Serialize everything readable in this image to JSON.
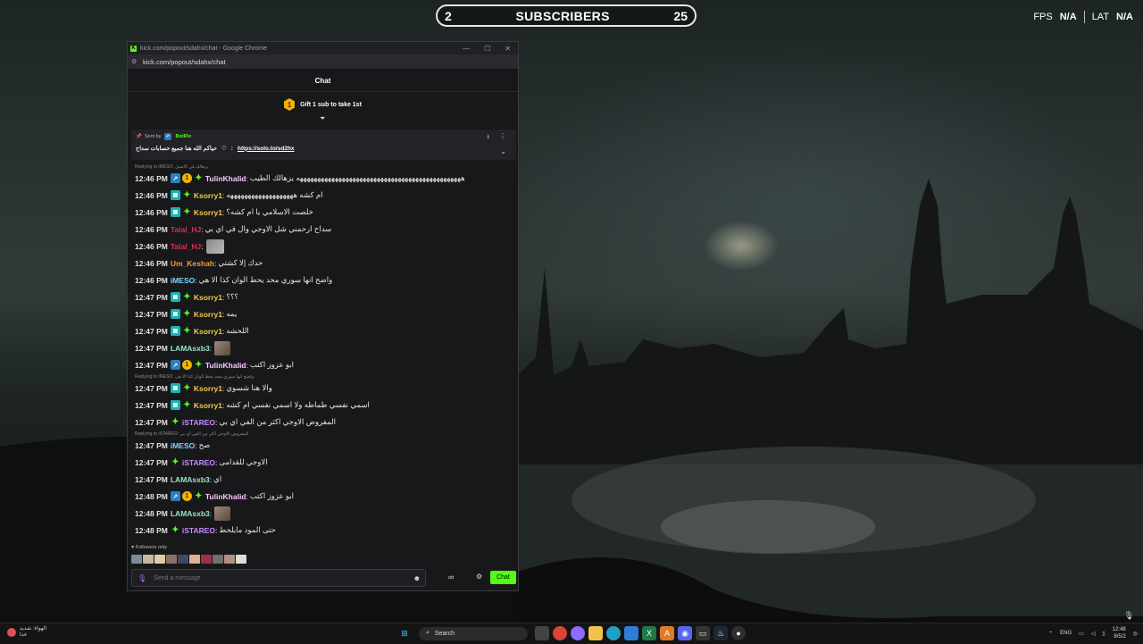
{
  "overlay": {
    "subscribers_left": "2",
    "subscribers_label": "SUBSCRIBERS",
    "subscribers_right": "25",
    "fps_label": "FPS",
    "fps_value": "N/A",
    "lat_label": "LAT",
    "lat_value": "N/A"
  },
  "window": {
    "title": "kick.com/popout/sdahx/chat - Google Chrome",
    "url": "kick.com/popout/sdahx/chat"
  },
  "chat": {
    "header": "Chat",
    "gift_rank": "1",
    "gift_text": "Gift 1 sub to take 1st",
    "pinned": {
      "sent_by": "Sent by",
      "bot_name": "BotRix",
      "message": "حياكم الله هنا جميع حسابات سداح",
      "link": "https://solo.to/sd2hx"
    },
    "messages": [
      {
        "reply": "Replying to iMESO: يزهالك في الاصيل",
        "time": "12:46 PM",
        "badges": [
          "blue",
          "gold",
          "star"
        ],
        "user": "TulinKhalid",
        "color": "#fcc8ff",
        "text": "هههههههههههههههههههههههههههههههههههههههههههههههه يزهالك الطيب"
      },
      {
        "time": "12:46 PM",
        "badges": [
          "teal",
          "star"
        ],
        "user": "Ksorry1",
        "color": "#f2c94c",
        "text": "ام كشه هههههههههههههههههههه"
      },
      {
        "time": "12:46 PM",
        "badges": [
          "teal",
          "star"
        ],
        "user": "Ksorry1",
        "color": "#f2c94c",
        "text": "خلصت الاسلامي يا ام كشه؟"
      },
      {
        "time": "12:46 PM",
        "badges": [],
        "user": "Talal_HJ",
        "color": "#d9304f",
        "text": "سداح ارحمني شل الاوجي وال في اي بي"
      },
      {
        "time": "12:46 PM",
        "badges": [],
        "user": "Talal_HJ",
        "color": "#d9304f",
        "text": "",
        "emote": true
      },
      {
        "time": "12:46 PM",
        "badges": [],
        "user": "Um_Keshah",
        "color": "#f29b38",
        "text": "حدك إلا كشتي"
      },
      {
        "time": "12:46 PM",
        "badges": [],
        "user": "iMESO",
        "color": "#7fd3ff",
        "text": "واضح انها سوري محد يحط الوان كذا الا هي"
      },
      {
        "time": "12:47 PM",
        "badges": [
          "teal",
          "star"
        ],
        "user": "Ksorry1",
        "color": "#f2c94c",
        "text": "؟؟؟"
      },
      {
        "time": "12:47 PM",
        "badges": [
          "teal",
          "star"
        ],
        "user": "Ksorry1",
        "color": "#f2c94c",
        "text": "يمه"
      },
      {
        "time": "12:47 PM",
        "badges": [
          "teal",
          "star"
        ],
        "user": "Ksorry1",
        "color": "#f2c94c",
        "text": "اللحشه"
      },
      {
        "time": "12:47 PM",
        "badges": [],
        "user": "LAMAsxb3",
        "color": "#9be3c5",
        "text": "",
        "emote": true
      },
      {
        "time": "12:47 PM",
        "badges": [
          "blue",
          "gold",
          "star"
        ],
        "user": "TulinKhalid",
        "color": "#fcc8ff",
        "text": "ابو عزوز اكتب"
      },
      {
        "reply": "Replying to iMESO: واضح انها سوري محد يحط الوان كذا الا هي",
        "time": "12:47 PM",
        "badges": [
          "teal",
          "star"
        ],
        "user": "Ksorry1",
        "color": "#f2c94c",
        "text": "والا هنا شسوي"
      },
      {
        "time": "12:47 PM",
        "badges": [
          "teal",
          "star"
        ],
        "user": "Ksorry1",
        "color": "#f2c94c",
        "text": "اسمي نفسي طماطه ولا اسمي نفسي ام كشه"
      },
      {
        "time": "12:47 PM",
        "badges": [
          "star"
        ],
        "user": "iSTAREO",
        "color": "#c58cff",
        "text": "المفروض الاوجي اكثر من الفي اي بي"
      },
      {
        "reply": "Replying to iSTAREO: المفروض الاوجي اكثر من الفي اي بي",
        "time": "12:47 PM",
        "badges": [],
        "user": "iMESO",
        "color": "#7fd3ff",
        "text": "صح"
      },
      {
        "time": "12:47 PM",
        "badges": [
          "star"
        ],
        "user": "iSTAREO",
        "color": "#c58cff",
        "text": "الاوجي للقدامى"
      },
      {
        "time": "12:47 PM",
        "badges": [],
        "user": "LAMAsxb3",
        "color": "#9be3c5",
        "text": "اي"
      },
      {
        "time": "12:48 PM",
        "badges": [
          "blue",
          "gold",
          "star"
        ],
        "user": "TulinKhalid",
        "color": "#fcc8ff",
        "text": "ابو عزوز اكتب"
      },
      {
        "time": "12:48 PM",
        "badges": [],
        "user": "LAMAsxb3",
        "color": "#9be3c5",
        "text": "",
        "emote": true
      },
      {
        "time": "12:48 PM",
        "badges": [
          "star"
        ],
        "user": "iSTAREO",
        "color": "#c58cff",
        "text": "حتى المود مايلحط"
      }
    ],
    "followers_only": "Followers only",
    "input_placeholder": "Send a message",
    "chat_button": "Chat"
  },
  "taskbar": {
    "weather_line1": "الهواء: شديد",
    "weather_line2": "غدا",
    "search_label": "Search",
    "lang": "ENG",
    "time": "12:48",
    "date": "8/5/2"
  },
  "colors": {
    "kick_green": "#53fc18",
    "chat_bg": "#18181b"
  }
}
